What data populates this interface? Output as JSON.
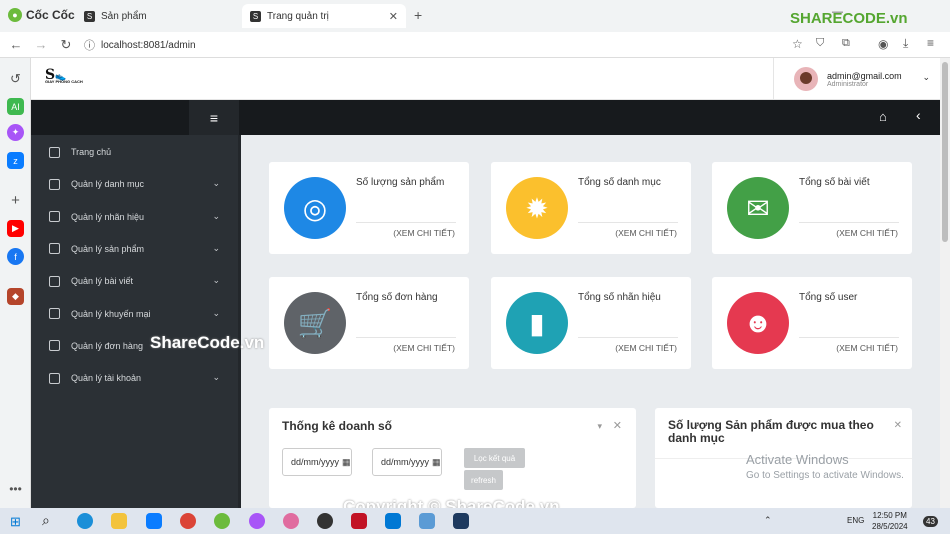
{
  "browser": {
    "brand": "Cốc Cốc",
    "tabs": [
      {
        "label": "Sản phẩm"
      },
      {
        "label": "Trang quản trị"
      }
    ],
    "url": "localhost:8081/admin",
    "sharecode_logo": "SHARECODE.vn"
  },
  "app": {
    "logo_text": "S",
    "logo_caption": "GIAY PHONG CACH",
    "user": {
      "email": "admin@gmail.com",
      "role": "Administrator"
    }
  },
  "sidebar": {
    "items": [
      {
        "label": "Trang chủ",
        "icon": "home-icon",
        "chevron": false
      },
      {
        "label": "Quản lý danh mục",
        "icon": "table-icon",
        "chevron": true
      },
      {
        "label": "Quản lý nhãn hiệu",
        "icon": "table-icon",
        "chevron": true
      },
      {
        "label": "Quản lý sản phẩm",
        "icon": "spinner-icon",
        "chevron": true
      },
      {
        "label": "Quản lý bài viết",
        "icon": "box-icon",
        "chevron": true
      },
      {
        "label": "Quản lý khuyến mại",
        "icon": "gift-icon",
        "chevron": true
      },
      {
        "label": "Quản lý đơn hàng",
        "icon": "cart-icon",
        "chevron": true
      },
      {
        "label": "Quản lý tài khoản",
        "icon": "users-icon",
        "chevron": true
      }
    ]
  },
  "cards": [
    {
      "title": "Số lượng sản phẩm",
      "more": "(XEM CHI TIẾT)",
      "color": "#1e88e5",
      "icon": "lifebuoy-icon"
    },
    {
      "title": "Tổng số danh mục",
      "more": "(XEM CHI TIẾT)",
      "color": "#fbc02d",
      "icon": "badge-icon"
    },
    {
      "title": "Tổng số bài viết",
      "more": "(XEM CHI TIẾT)",
      "color": "#43a047",
      "icon": "envelopes-icon"
    },
    {
      "title": "Tổng số đơn hàng",
      "more": "(XEM CHI TIẾT)",
      "color": "#5f6368",
      "icon": "cart-icon"
    },
    {
      "title": "Tổng số nhãn hiệu",
      "more": "(XEM CHI TIẾT)",
      "color": "#1fa2b4",
      "icon": "bookmark-icon"
    },
    {
      "title": "Tổng số user",
      "more": "(XEM CHI TIẾT)",
      "color": "#e53950",
      "icon": "worker-icon"
    }
  ],
  "sales_panel": {
    "title": "Thống kê doanh số",
    "date_placeholder": "dd/mm/yyyy",
    "filter_label": "Lọc kết quả",
    "refresh_label": "refresh"
  },
  "products_panel": {
    "title": "Số lượng Sản phẩm được mua theo danh mục"
  },
  "overlay": {
    "watermark_center": "ShareCode.vn",
    "watermark_bottom": "Copyright © ShareCode.vn",
    "activate_title": "Activate Windows",
    "activate_sub": "Go to Settings to activate Windows."
  },
  "taskbar": {
    "time": "12:50 PM",
    "date": "28/5/2024",
    "lang": "ENG",
    "badge": "43"
  }
}
